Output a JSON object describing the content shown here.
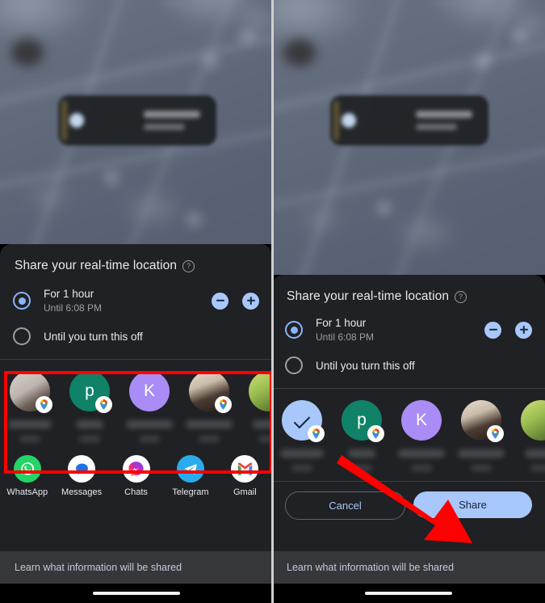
{
  "screenshot": {
    "type": "android-google-maps-location-sharing",
    "panels": [
      "left",
      "right"
    ]
  },
  "sheet": {
    "title": "Share your real-time location",
    "help_icon": "help-question-icon",
    "options": [
      {
        "id": "for-1-hour",
        "label": "For 1 hour",
        "sublabel": "Until 6:08 PM",
        "selected": true,
        "stepper_minus": "minus-icon",
        "stepper_plus": "plus-icon"
      },
      {
        "id": "until-you-turn-off",
        "label": "Until you turn this off",
        "sublabel": "",
        "selected": false
      }
    ],
    "footer_link": "Learn what information will be shared"
  },
  "contacts_left": [
    {
      "id": "contact-1",
      "avatar_type": "photo",
      "avatar_style": "ph-a",
      "initial": "",
      "badge": "maps-pin-icon",
      "selected": false,
      "name_redacted": true
    },
    {
      "id": "contact-2",
      "avatar_type": "initial",
      "avatar_style": "",
      "initial": "p",
      "color": "#0f8267",
      "badge": "maps-pin-icon",
      "selected": false,
      "name_redacted": true
    },
    {
      "id": "contact-3",
      "avatar_type": "initial",
      "avatar_style": "",
      "initial": "K",
      "color": "#a98cf5",
      "badge": "",
      "selected": false,
      "name_redacted": true
    },
    {
      "id": "contact-4",
      "avatar_type": "photo",
      "avatar_style": "ph-b",
      "initial": "",
      "badge": "maps-pin-icon",
      "selected": false,
      "name_redacted": true
    },
    {
      "id": "contact-5",
      "avatar_type": "photo",
      "avatar_style": "ph-c",
      "initial": "",
      "badge": "",
      "selected": false,
      "name_redacted": true
    }
  ],
  "contacts_right": [
    {
      "id": "contact-1",
      "avatar_type": "selected",
      "avatar_style": "",
      "initial": "",
      "color": "#a8c7fa",
      "badge": "maps-pin-icon",
      "selected": true,
      "name_redacted": true
    },
    {
      "id": "contact-2",
      "avatar_type": "initial",
      "avatar_style": "",
      "initial": "p",
      "color": "#0f8267",
      "badge": "maps-pin-icon",
      "selected": false,
      "name_redacted": true
    },
    {
      "id": "contact-3",
      "avatar_type": "initial",
      "avatar_style": "",
      "initial": "K",
      "color": "#a98cf5",
      "badge": "",
      "selected": false,
      "name_redacted": true
    },
    {
      "id": "contact-4",
      "avatar_type": "photo",
      "avatar_style": "ph-b",
      "initial": "",
      "badge": "maps-pin-icon",
      "selected": false,
      "name_redacted": true
    },
    {
      "id": "contact-5",
      "avatar_type": "photo",
      "avatar_style": "ph-c",
      "initial": "",
      "badge": "",
      "selected": false,
      "name_redacted": true
    }
  ],
  "apps": [
    {
      "id": "whatsapp",
      "label": "WhatsApp",
      "icon": "whatsapp-icon",
      "color": "#25d366"
    },
    {
      "id": "messages",
      "label": "Messages",
      "icon": "messages-icon",
      "color": "#ffffff"
    },
    {
      "id": "chats",
      "label": "Chats",
      "icon": "messenger-icon",
      "color": "#ffffff"
    },
    {
      "id": "telegram",
      "label": "Telegram",
      "icon": "telegram-icon",
      "color": "#2aabee"
    },
    {
      "id": "gmail",
      "label": "Gmail",
      "icon": "gmail-icon",
      "color": "#ffffff"
    }
  ],
  "buttons": {
    "cancel": "Cancel",
    "share": "Share"
  },
  "annotations": {
    "highlight_box_color": "#ff0000",
    "arrow_color": "#ff0000",
    "highlight_target": "contacts-row",
    "arrow_target": "share-button"
  },
  "colors": {
    "sheet_bg": "#202124",
    "accent_blue": "#a8c7fa",
    "radio_blue": "#8ab4f8",
    "text_primary": "#e8eaed",
    "text_secondary": "#9aa0a6",
    "learn_bar": "#35373b"
  }
}
